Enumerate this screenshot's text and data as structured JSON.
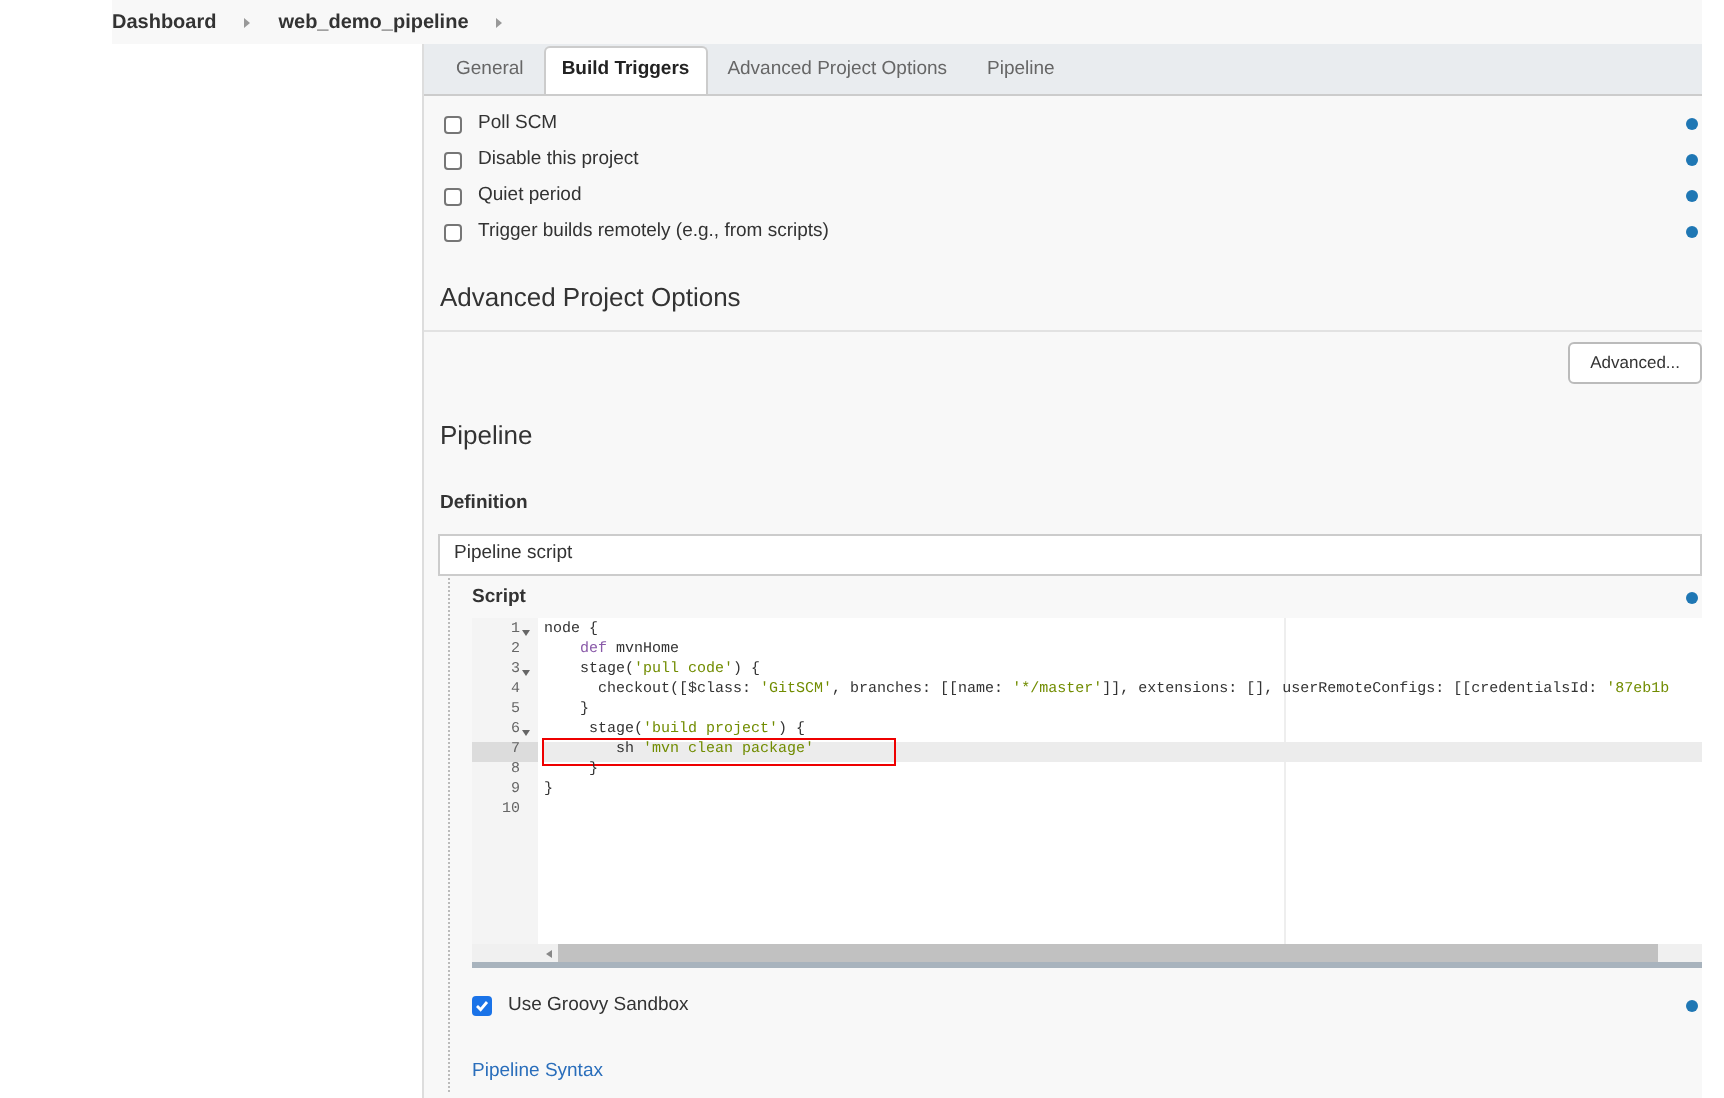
{
  "breadcrumb": [
    "Dashboard",
    "web_demo_pipeline"
  ],
  "tabs": [
    {
      "label": "General",
      "selected": false
    },
    {
      "label": "Build Triggers",
      "selected": true
    },
    {
      "label": "Advanced Project Options",
      "selected": false
    },
    {
      "label": "Pipeline",
      "selected": false
    }
  ],
  "triggers": [
    {
      "label": "Poll SCM",
      "checked": false
    },
    {
      "label": "Disable this project",
      "checked": false
    },
    {
      "label": "Quiet period",
      "checked": false
    },
    {
      "label": "Trigger builds remotely (e.g., from scripts)",
      "checked": false
    }
  ],
  "advanced_section": {
    "title": "Advanced Project Options",
    "button": "Advanced..."
  },
  "pipeline": {
    "title": "Pipeline",
    "definition_label": "Definition",
    "definition_value": "Pipeline script",
    "script_label": "Script",
    "lines": [
      {
        "number": "1",
        "fold": true,
        "active": false,
        "boxed": false,
        "tokens": [
          {
            "kind": "plain",
            "text": "node {"
          }
        ]
      },
      {
        "number": "2",
        "fold": false,
        "active": false,
        "boxed": false,
        "tokens": [
          {
            "kind": "keyword",
            "text": "    def"
          },
          {
            "kind": "plain",
            "text": " mvnHome"
          }
        ]
      },
      {
        "number": "3",
        "fold": true,
        "active": false,
        "boxed": false,
        "tokens": [
          {
            "kind": "plain",
            "text": "    stage("
          },
          {
            "kind": "string",
            "text": "'pull code'"
          },
          {
            "kind": "plain",
            "text": ") {"
          }
        ]
      },
      {
        "number": "4",
        "fold": false,
        "active": false,
        "boxed": false,
        "tokens": [
          {
            "kind": "plain",
            "text": "      checkout([$class: "
          },
          {
            "kind": "string",
            "text": "'GitSCM'"
          },
          {
            "kind": "plain",
            "text": ", branches: [[name: "
          },
          {
            "kind": "string",
            "text": "'*/master'"
          },
          {
            "kind": "plain",
            "text": "]], extensions: [], userRemoteConfigs: [[credentialsId: "
          },
          {
            "kind": "string",
            "text": "'87eb1b"
          }
        ]
      },
      {
        "number": "5",
        "fold": false,
        "active": false,
        "boxed": false,
        "tokens": [
          {
            "kind": "plain",
            "text": "    }"
          }
        ]
      },
      {
        "number": "6",
        "fold": true,
        "active": false,
        "boxed": false,
        "tokens": [
          {
            "kind": "plain",
            "text": "     stage("
          },
          {
            "kind": "string",
            "text": "'build project'"
          },
          {
            "kind": "plain",
            "text": ") {"
          }
        ]
      },
      {
        "number": "7",
        "fold": false,
        "active": true,
        "boxed": true,
        "tokens": [
          {
            "kind": "plain",
            "text": "        sh "
          },
          {
            "kind": "string",
            "text": "'mvn clean package'"
          }
        ]
      },
      {
        "number": "8",
        "fold": false,
        "active": false,
        "boxed": false,
        "tokens": [
          {
            "kind": "plain",
            "text": "     }"
          }
        ]
      },
      {
        "number": "9",
        "fold": false,
        "active": false,
        "boxed": false,
        "tokens": [
          {
            "kind": "plain",
            "text": "}"
          }
        ]
      },
      {
        "number": "10",
        "fold": false,
        "active": false,
        "boxed": false
      }
    ],
    "sandbox": {
      "label": "Use Groovy Sandbox",
      "checked": true
    },
    "syntax_link": "Pipeline Syntax"
  }
}
